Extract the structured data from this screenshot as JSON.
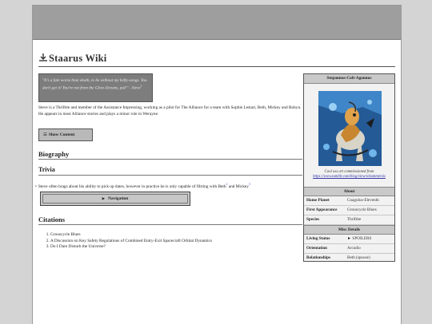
{
  "wiki": {
    "title": "Staarus Wiki"
  },
  "quote": {
    "text": "\"It's a fate worse than death, to be without my hefty-songs. You don't get it! You're not from the Glow-Oceans, pal!\" - Steve",
    "ref": "1"
  },
  "intro": {
    "text": "Steve is a Thriftite and member of the Assistance Impressing, working as a pilot for The Alliance for a team with Sophie Lestari, Beth, Mickey and Robyn. He appears in most Alliance stories and plays a minor role in Werayne."
  },
  "show_content": {
    "icon": "list-icon",
    "label": "Show Content"
  },
  "sections": {
    "biography": "Biography",
    "trivia": "Trivia",
    "citations": "Citations"
  },
  "trivia": {
    "bullet": "•",
    "text_before": "Steve often brags about his ability to pick up dates, however in practice he is only capable of flirting with Beth",
    "ref_a": "2",
    "text_mid": " and Mickey",
    "ref_b": "3"
  },
  "navigation": {
    "icon": "triangle-right-icon",
    "label": "Navigation"
  },
  "citations": [
    "Grouscycle Blues",
    "A Discussion on Key Safety Regulations of Combined Entry-Exit Spacecraft Orbital Dynamics",
    "Do I Dare Disturb the Universe?"
  ],
  "infobox": {
    "name": "Stepannus-Coft-Agonnus",
    "caption": "Cool ass art commissioned from",
    "caption_link": "https://www.tumblr.com/blog/view/whammerzis",
    "about_header": "About",
    "about_rows": [
      {
        "key": "Home Planet",
        "value": "Coagulus-Eleventh"
      },
      {
        "key": "First Appearance",
        "value": "Grouscycle Blues"
      },
      {
        "key": "Species",
        "value": "Thriftite"
      }
    ],
    "misc_header": "Misc Details",
    "misc_rows": [
      {
        "key": "Living Status",
        "value": "► SPOILERS"
      },
      {
        "key": "Orientation",
        "value": "Arcadio"
      },
      {
        "key": "Relationships",
        "value": "Beth (spouse)"
      }
    ]
  },
  "colors": {
    "topbar": "#9e9e9e",
    "background": "#d4d4d4",
    "quote_bg": "#7d7d7d",
    "infobox_header": "#c9c9c9",
    "link": "#3333aa"
  }
}
